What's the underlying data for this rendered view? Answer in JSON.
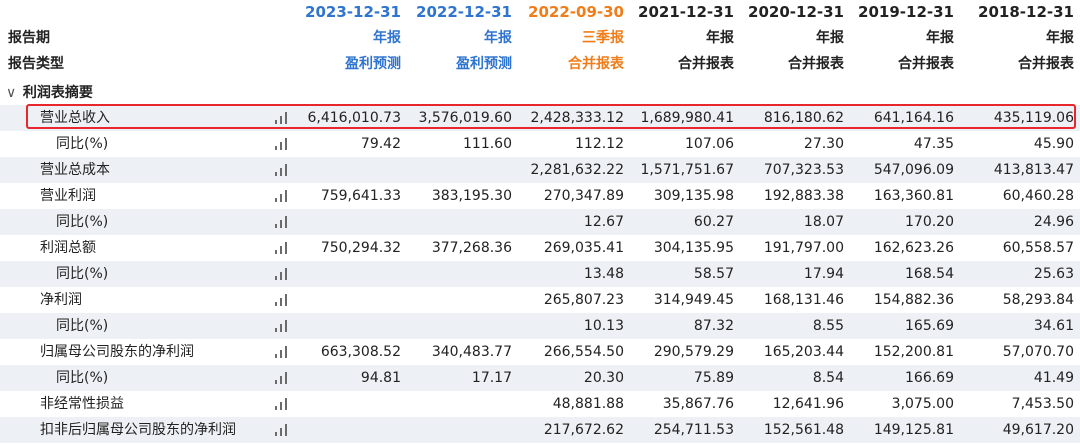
{
  "header": {
    "period_label": "报告期",
    "kind_label": "报告类型",
    "columns": [
      {
        "date": "2023-12-31",
        "period": "年报",
        "kind": "盈利预测",
        "color": "#2f74cf"
      },
      {
        "date": "2022-12-31",
        "period": "年报",
        "kind": "盈利预测",
        "color": "#2f74cf"
      },
      {
        "date": "2022-09-30",
        "period": "三季报",
        "kind": "合并报表",
        "color": "#f07d19"
      },
      {
        "date": "2021-12-31",
        "period": "年报",
        "kind": "合并报表",
        "color": "#222222"
      },
      {
        "date": "2020-12-31",
        "period": "年报",
        "kind": "合并报表",
        "color": "#222222"
      },
      {
        "date": "2019-12-31",
        "period": "年报",
        "kind": "合并报表",
        "color": "#222222"
      },
      {
        "date": "2018-12-31",
        "period": "年报",
        "kind": "合并报表",
        "color": "#222222"
      }
    ]
  },
  "section": {
    "title": "利润表摘要",
    "chevron": "∨"
  },
  "highlight_color": "#e8262b",
  "rows": [
    {
      "label": "营业总收入",
      "values": [
        "6,416,010.73",
        "3,576,019.60",
        "2,428,333.12",
        "1,689,980.41",
        "816,180.62",
        "641,164.16",
        "435,119.06"
      ]
    },
    {
      "label": "同比(%)",
      "values": [
        "79.42",
        "111.60",
        "112.12",
        "107.06",
        "27.30",
        "47.35",
        "45.90"
      ]
    },
    {
      "label": "营业总成本",
      "values": [
        "",
        "",
        "2,281,632.22",
        "1,571,751.67",
        "707,323.53",
        "547,096.09",
        "413,813.47"
      ]
    },
    {
      "label": "营业利润",
      "values": [
        "759,641.33",
        "383,195.30",
        "270,347.89",
        "309,135.98",
        "192,883.38",
        "163,360.81",
        "60,460.28"
      ]
    },
    {
      "label": "同比(%)",
      "values": [
        "",
        "",
        "12.67",
        "60.27",
        "18.07",
        "170.20",
        "24.96"
      ]
    },
    {
      "label": "利润总额",
      "values": [
        "750,294.32",
        "377,268.36",
        "269,035.41",
        "304,135.95",
        "191,797.00",
        "162,623.26",
        "60,558.57"
      ]
    },
    {
      "label": "同比(%)",
      "values": [
        "",
        "",
        "13.48",
        "58.57",
        "17.94",
        "168.54",
        "25.63"
      ]
    },
    {
      "label": "净利润",
      "values": [
        "",
        "",
        "265,807.23",
        "314,949.45",
        "168,131.46",
        "154,882.36",
        "58,293.84"
      ]
    },
    {
      "label": "同比(%)",
      "values": [
        "",
        "",
        "10.13",
        "87.32",
        "8.55",
        "165.69",
        "34.61"
      ]
    },
    {
      "label": "归属母公司股东的净利润",
      "values": [
        "663,308.52",
        "340,483.77",
        "266,554.50",
        "290,579.29",
        "165,203.44",
        "152,200.81",
        "57,070.70"
      ]
    },
    {
      "label": "同比(%)",
      "values": [
        "94.81",
        "17.17",
        "20.30",
        "75.89",
        "8.54",
        "166.69",
        "41.49"
      ]
    },
    {
      "label": "非经常性损益",
      "values": [
        "",
        "",
        "48,881.88",
        "35,867.76",
        "12,641.96",
        "3,075.00",
        "7,453.50"
      ]
    },
    {
      "label": "扣非后归属母公司股东的净利润",
      "values": [
        "",
        "",
        "217,672.62",
        "254,711.53",
        "152,561.48",
        "149,125.81",
        "49,617.20"
      ]
    }
  ]
}
